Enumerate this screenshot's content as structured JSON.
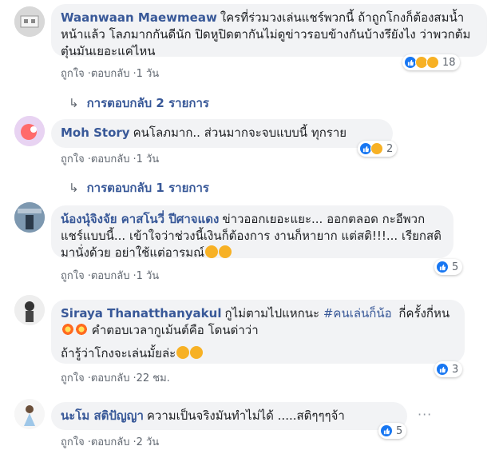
{
  "comments": [
    {
      "name": "Waanwaan Maewmeaw",
      "text": "ใครที่ร่วมวงเล่นแชร์พวกนี้ ถ้าถูกโกงก็ต้องสมน้ำหน้าแล้ว โลภมากกันดีนัก ปิดหูปิดตากันไม่ดูข่าวรอบข้างกันบ้างรึยังไง ว่าพวกต้มตุ๋นมันเยอะแค่ไหน",
      "like": "ถูกใจ",
      "reply": "ตอบกลับ",
      "time": "1 วัน",
      "reaction_count": "18",
      "reactions": [
        "like-icon",
        "haha-icon",
        "wow-icon"
      ],
      "replies_label": "การตอบกลับ 2 รายการ"
    },
    {
      "name": "Moh Story",
      "text": "คนโลภมาก.. ส่วนมากจะจบแบบนี้ ทุกราย",
      "like": "ถูกใจ",
      "reply": "ตอบกลับ",
      "time": "1 วัน",
      "reaction_count": "2",
      "reactions": [
        "like-icon",
        "haha-icon"
      ],
      "replies_label": "การตอบกลับ 1 รายการ"
    },
    {
      "name": "น้องนุ๋จิงจัย คาสโนวี่ ปีศาจแดง",
      "text": "ข่าวออกเยอะแยะ... ออกตลอด กะอีพวกแชร์แบบนี้... เข้าใจว่าช่วงนี้เงินก็ต้องการ งานก็หายาก แต่สติ!!!... เรียกสติมานั่งด้วย อย่าใช้แต่อารมณ์",
      "like": "ถูกใจ",
      "reply": "ตอบกลับ",
      "time": "1 วัน",
      "reaction_count": "5",
      "reactions": [
        "like-icon"
      ]
    },
    {
      "name": "Siraya Thanatthanyakul",
      "text1": "กูไม่ตามไปแหกนะ",
      "hashtag": "#คนเล่นก็น้อ",
      "text2": "กี่ครั้งกี่หน",
      "text3": "คำตอบเวลากูเม้นต์คือ โดนด่าว่า",
      "text4": "ถ้ารู้ว่าโกงจะเล่นมั้ยล่ะ",
      "like": "ถูกใจ",
      "reply": "ตอบกลับ",
      "time": "22 ชม.",
      "reaction_count": "3",
      "reactions": [
        "like-icon"
      ]
    },
    {
      "name": "นะโม สติปัญญา",
      "text": "ความเป็นจริงมันทำไม่ได้ .....สติๆๆๆจ้า",
      "like": "ถูกใจ",
      "reply": "ตอบกลับ",
      "time": "2 วัน",
      "reaction_count": "5",
      "reactions": [
        "like-icon"
      ],
      "more": "···"
    }
  ],
  "colors": {
    "name": "#385898",
    "bubble": "#f2f3f5",
    "meta": "#606770",
    "like": "#1877f2",
    "emoji": "#f7b125"
  }
}
